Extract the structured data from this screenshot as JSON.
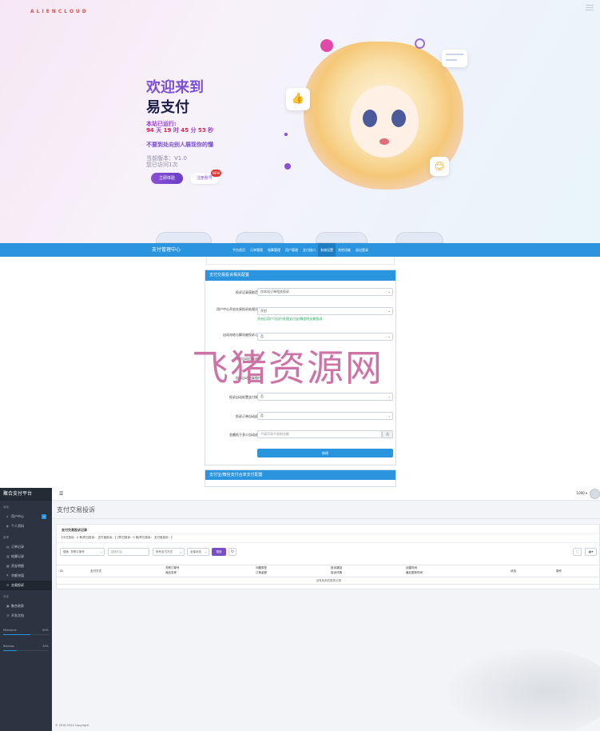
{
  "hero": {
    "logo": "ALIENCLOUD",
    "welcome": "欢迎来到",
    "title": "易支付",
    "run_label": "本站已运行:",
    "run_days": "94",
    "run_hours": "19",
    "run_minutes": "45",
    "run_seconds": "53",
    "unit_day": "天",
    "unit_hour": "时",
    "unit_minute": "分",
    "unit_second": "秒",
    "slogan": "不要到处向别人展现你的懂",
    "version": "当前版本：V1.0",
    "visits": "您已访问1次",
    "btn_experience": "立即体验",
    "btn_register": "注册账号",
    "new_badge": "NEW"
  },
  "admin": {
    "brand": "支付管理中心",
    "nav": [
      "平台首页",
      "订单管理",
      "结算管理",
      "用户管理",
      "支付接口",
      "系统设置",
      "其他功能",
      "退出登录"
    ],
    "active_nav_index": 5,
    "panel_title": "支付交易投诉相关配置",
    "rows": [
      {
        "label": "投诉记录获取范围",
        "value": "仅本站订单相关投诉"
      },
      {
        "label": "用户中心开启交易投诉处理功能",
        "value": "开启",
        "hint": "开启后用户可自行处理支付宝/微信的交易投诉"
      },
      {
        "label": "自动冻结与解冻被投诉订单",
        "value": "否"
      },
      {
        "label": "投诉自动回复内容",
        "value": ""
      },
      {
        "label": "投诉自动回复图片",
        "value": ""
      },
      {
        "label": "投诉自动处置支付账号",
        "value": "否"
      },
      {
        "label": "投诉订单自动退款",
        "value": "否"
      },
      {
        "label": "金额低于多少自动退款",
        "placeholder": "不填写则不限制金额",
        "unit": "元"
      }
    ],
    "submit": "修改",
    "panel2_title": "支付宝/微信支付合单支付配置",
    "watermark": "飞猪资源网"
  },
  "dash": {
    "brand": "聚合支付平台",
    "sections": {
      "overview": "面板",
      "manage": "管理",
      "other": "其他"
    },
    "menu_overview": [
      {
        "label": "用户中心",
        "icon": "home-icon",
        "badge": "1"
      },
      {
        "label": "个人资料",
        "icon": "user-icon"
      }
    ],
    "menu_manage": [
      {
        "label": "订单记录",
        "icon": "order-icon"
      },
      {
        "label": "结算记录",
        "icon": "settle-icon"
      },
      {
        "label": "资金明细",
        "icon": "money-icon"
      },
      {
        "label": "余额充值",
        "icon": "recharge-icon"
      },
      {
        "label": "交易投诉",
        "icon": "complaint-icon",
        "active": true
      }
    ],
    "menu_other": [
      {
        "label": "聚合收款",
        "icon": "qrcode-icon"
      },
      {
        "label": "开发文档",
        "icon": "doc-icon"
      }
    ],
    "progress": [
      {
        "label": "Milestone",
        "percent": "60%",
        "value": 0.6
      },
      {
        "label": "Release",
        "percent": "30%",
        "value": 0.3
      }
    ],
    "user": "1000 ▾",
    "page_title": "支付交易投诉",
    "card_title": "支付交易投诉记录",
    "stats": "【今日投诉：0 条|昨日投诉：  支付宝投诉：】【昨日投诉：0 条|昨日投诉：  支付宝投诉：】",
    "filter": {
      "search_label": "搜索",
      "field_select": "关联订单号",
      "keyword_placeholder": "搜索内容",
      "paytype_select": "所有支付方式",
      "status_select": "全部状态",
      "search_button": "搜索",
      "refresh_icon": "↻"
    },
    "columns": [
      {
        "line1": "ID",
        "line2": ""
      },
      {
        "line1": "支付方式",
        "line2": ""
      },
      {
        "line1": "关联订单号",
        "line2": "商品名称"
      },
      {
        "line1": "问题类型",
        "line2": "订单金额"
      },
      {
        "line1": "投诉原因",
        "line2": "投诉详情"
      },
      {
        "line1": "创建时间",
        "line2": "最后更新时间"
      },
      {
        "line1": "状态",
        "line2": ""
      },
      {
        "line1": "操作",
        "line2": ""
      }
    ],
    "empty_text": "没有找到匹配的记录",
    "footer": "© 2016-2024 Copyright."
  }
}
